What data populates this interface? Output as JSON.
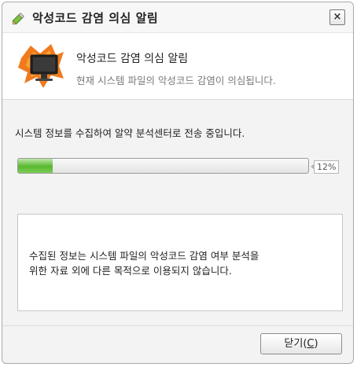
{
  "window": {
    "title": "악성코드 감염 의심 알림",
    "close_glyph": "×",
    "title_icon": "pencil-icon"
  },
  "header": {
    "icon": "computer-warning-icon",
    "title": "악성코드 감염 의심 알림",
    "subtitle": "현재 시스템 파일의 악성코드 감염이 의심됩니다."
  },
  "status": {
    "message": "시스템 정보를 수집하여 알약 분석센터로 전송 중입니다."
  },
  "progress": {
    "value": 0.12,
    "label": "12%",
    "fill_color": "#58b830"
  },
  "info": {
    "text": "수집된 정보는 시스템 파일의 악성코드 감염 여부 분석을\n위한 자료 외에 다른 목적으로 이용되지 않습니다."
  },
  "footer": {
    "close_label_prefix": "닫기(",
    "close_label_hotkey": "C",
    "close_label_suffix": ")"
  }
}
